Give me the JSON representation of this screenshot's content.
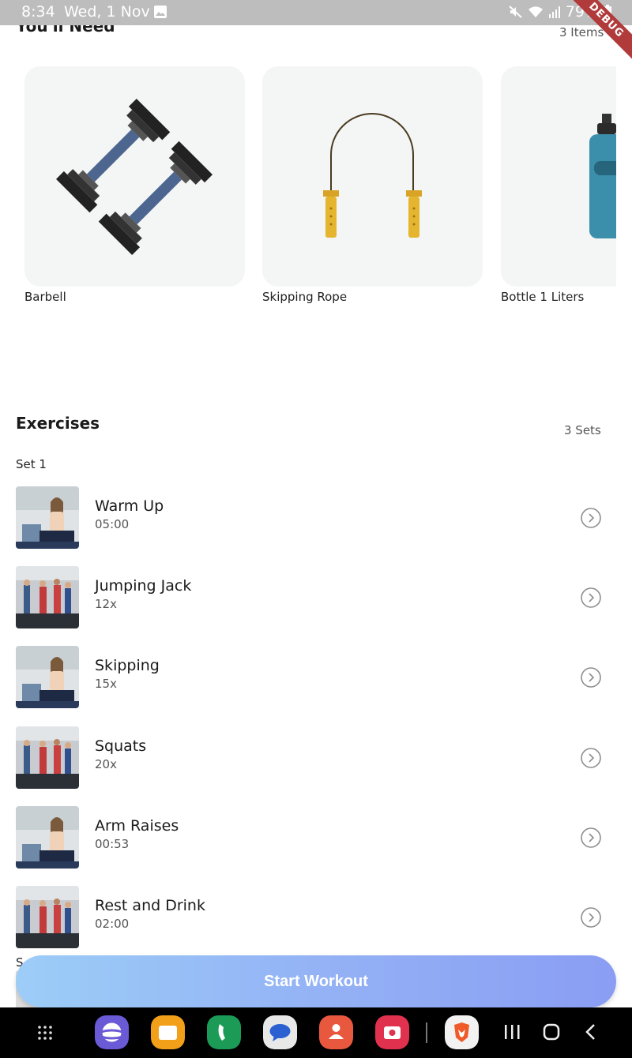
{
  "status_bar": {
    "time": "8:34",
    "date": "Wed, 1 Nov",
    "battery": "79%",
    "icons": [
      "gallery-icon",
      "mute-icon",
      "wifi-icon",
      "signal-icon",
      "battery-icon"
    ]
  },
  "debug_banner": "DEBUG",
  "equipment": {
    "title": "You'll Need",
    "count": "3 Items",
    "items": [
      {
        "label": "Barbell",
        "icon": "dumbbell-icon"
      },
      {
        "label": "Skipping Rope",
        "icon": "skipping-rope-icon"
      },
      {
        "label": "Bottle 1 Liters",
        "icon": "water-bottle-icon"
      }
    ]
  },
  "exercises": {
    "title": "Exercises",
    "count": "3 Sets",
    "set_label": "Set 1",
    "items": [
      {
        "name": "Warm Up",
        "detail": "05:00",
        "thumb": "treadmill-photo"
      },
      {
        "name": "Jumping Jack",
        "detail": "12x",
        "thumb": "gym-group-photo"
      },
      {
        "name": "Skipping",
        "detail": "15x",
        "thumb": "treadmill-photo"
      },
      {
        "name": "Squats",
        "detail": "20x",
        "thumb": "gym-group-photo"
      },
      {
        "name": "Arm Raises",
        "detail": "00:53",
        "thumb": "treadmill-photo"
      },
      {
        "name": "Rest and Drink",
        "detail": "02:00",
        "thumb": "gym-group-photo"
      }
    ],
    "next_set_label": "S"
  },
  "start_button": "Start Workout",
  "colors": {
    "button_gradient_start": "#9ccdf7",
    "button_gradient_end": "#8a9df3",
    "card_background": "#f4f6f5",
    "status_bar": "#bdbdbd"
  },
  "nav_bar": {
    "apps": [
      "internet-app-icon",
      "files-app-icon",
      "phone-app-icon",
      "messages-app-icon",
      "contacts-app-icon",
      "camera-app-icon",
      "brave-app-icon"
    ],
    "buttons": [
      "app-grid-icon",
      "recents-icon",
      "home-icon",
      "back-icon"
    ]
  }
}
